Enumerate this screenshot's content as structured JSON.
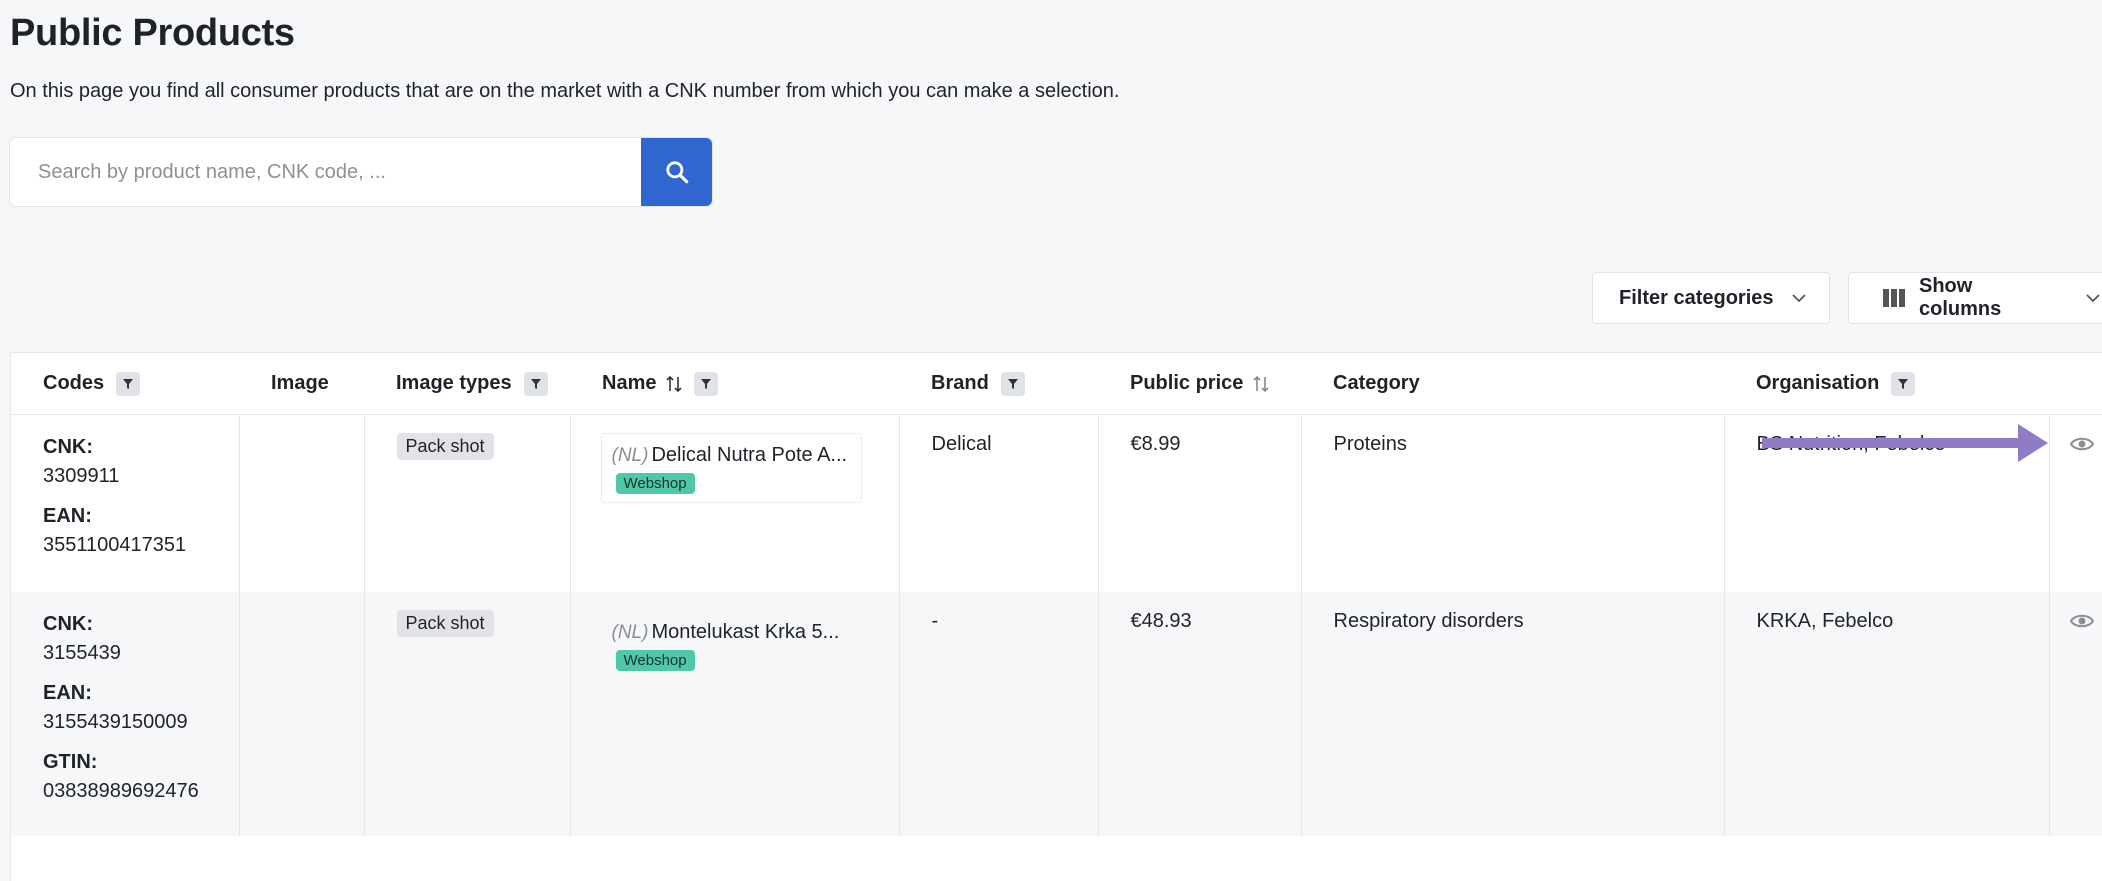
{
  "page": {
    "title": "Public Products",
    "description": "On this page you find all consumer products that are on the market with a CNK number from which you can make a selection."
  },
  "search": {
    "placeholder": "Search by product name, CNK code, ..."
  },
  "toolbar": {
    "filter_categories": "Filter categories",
    "show_columns": "Show columns"
  },
  "table": {
    "columns": {
      "codes": "Codes",
      "image": "Image",
      "image_types": "Image types",
      "name": "Name",
      "brand": "Brand",
      "public_price": "Public price",
      "category": "Category",
      "organisation": "Organisation"
    },
    "rows": [
      {
        "cnk_label": "CNK:",
        "cnk": "3309911",
        "ean_label": "EAN:",
        "ean": "3551100417351",
        "image_type": "Pack shot",
        "lang": "(NL)",
        "name": "Delical Nutra Pote A...",
        "channel": "Webshop",
        "brand": "Delical",
        "price": "€8.99",
        "category": "Proteins",
        "organisation": "BS Nutrition, Febelco"
      },
      {
        "cnk_label": "CNK:",
        "cnk": "3155439",
        "ean_label": "EAN:",
        "ean": "3155439150009",
        "gtin_label": "GTIN:",
        "gtin": "03838989692476",
        "image_type": "Pack shot",
        "lang": "(NL)",
        "name": "Montelukast Krka 5...",
        "channel": "Webshop",
        "brand": "-",
        "price": "€48.93",
        "category": "Respiratory disorders",
        "organisation": "KRKA, Febelco"
      }
    ]
  },
  "colors": {
    "primary": "#2f66d0",
    "badge": "#4fc7a8",
    "annotation_arrow": "#8f7cc4"
  },
  "icons": [
    "search-icon",
    "chevron-down-icon",
    "columns-icon",
    "filter-icon",
    "sort-icon",
    "eye-icon",
    "arrow-right-icon"
  ]
}
